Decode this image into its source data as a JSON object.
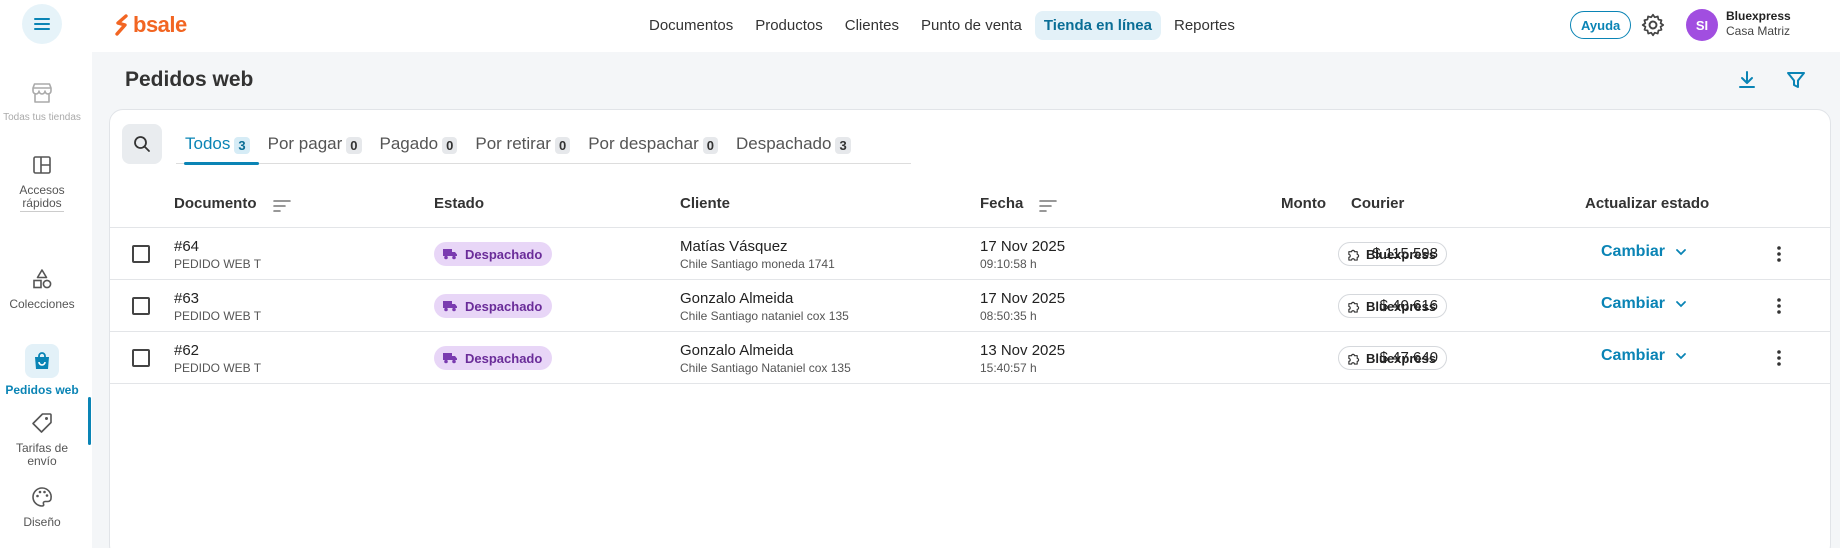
{
  "app": {
    "logo_text": "bsale",
    "brand_color": "#f26522",
    "accent_color": "#0a84b5"
  },
  "nav": {
    "items": [
      {
        "label": "Documentos"
      },
      {
        "label": "Productos"
      },
      {
        "label": "Clientes"
      },
      {
        "label": "Punto de venta"
      },
      {
        "label": "Tienda en línea",
        "active": true
      },
      {
        "label": "Reportes"
      }
    ]
  },
  "topbar": {
    "help_label": "Ayuda",
    "avatar_initials": "SI",
    "account_name": "Bluexpress",
    "account_branch": "Casa Matriz"
  },
  "sidebar": {
    "items": [
      {
        "label": "Todas tus tiendas",
        "icon": "store-icon"
      },
      {
        "label": "Accesos rápidos",
        "icon": "layout-icon"
      },
      {
        "label": "Colecciones",
        "icon": "shapes-icon"
      },
      {
        "label": "Pedidos web",
        "icon": "shopping-bag-icon",
        "active": true
      },
      {
        "label": "Tarifas de envío",
        "icon": "tag-icon"
      },
      {
        "label": "Diseño",
        "icon": "palette-icon"
      }
    ]
  },
  "page": {
    "title": "Pedidos web"
  },
  "tabs": [
    {
      "label": "Todos",
      "count": "3",
      "active": true
    },
    {
      "label": "Por pagar",
      "count": "0"
    },
    {
      "label": "Pagado",
      "count": "0"
    },
    {
      "label": "Por retirar",
      "count": "0"
    },
    {
      "label": "Por despachar",
      "count": "0"
    },
    {
      "label": "Despachado",
      "count": "3"
    }
  ],
  "table": {
    "columns": {
      "documento": "Documento",
      "estado": "Estado",
      "cliente": "Cliente",
      "fecha": "Fecha",
      "monto": "Monto",
      "courier": "Courier",
      "actualizar": "Actualizar estado"
    },
    "rows": [
      {
        "doc_number": "#64",
        "doc_type": "PEDIDO WEB T",
        "status": "Despachado",
        "client_name": "Matías Vásquez",
        "client_address": "Chile Santiago moneda 1741",
        "date": "17 Nov 2025",
        "time": "09:10:58 h",
        "amount": "$ 115.598",
        "courier": "Bluexpress",
        "action": "Cambiar"
      },
      {
        "doc_number": "#63",
        "doc_type": "PEDIDO WEB T",
        "status": "Despachado",
        "client_name": "Gonzalo Almeida",
        "client_address": "Chile Santiago nataniel cox 135",
        "date": "17 Nov 2025",
        "time": "08:50:35 h",
        "amount": "$ 40.616",
        "courier": "Bluexpress",
        "action": "Cambiar"
      },
      {
        "doc_number": "#62",
        "doc_type": "PEDIDO WEB T",
        "status": "Despachado",
        "client_name": "Gonzalo Almeida",
        "client_address": "Chile Santiago Nataniel cox 135",
        "date": "13 Nov 2025",
        "time": "15:40:57 h",
        "amount": "$ 47.640",
        "courier": "Bluexpress",
        "action": "Cambiar"
      }
    ]
  }
}
